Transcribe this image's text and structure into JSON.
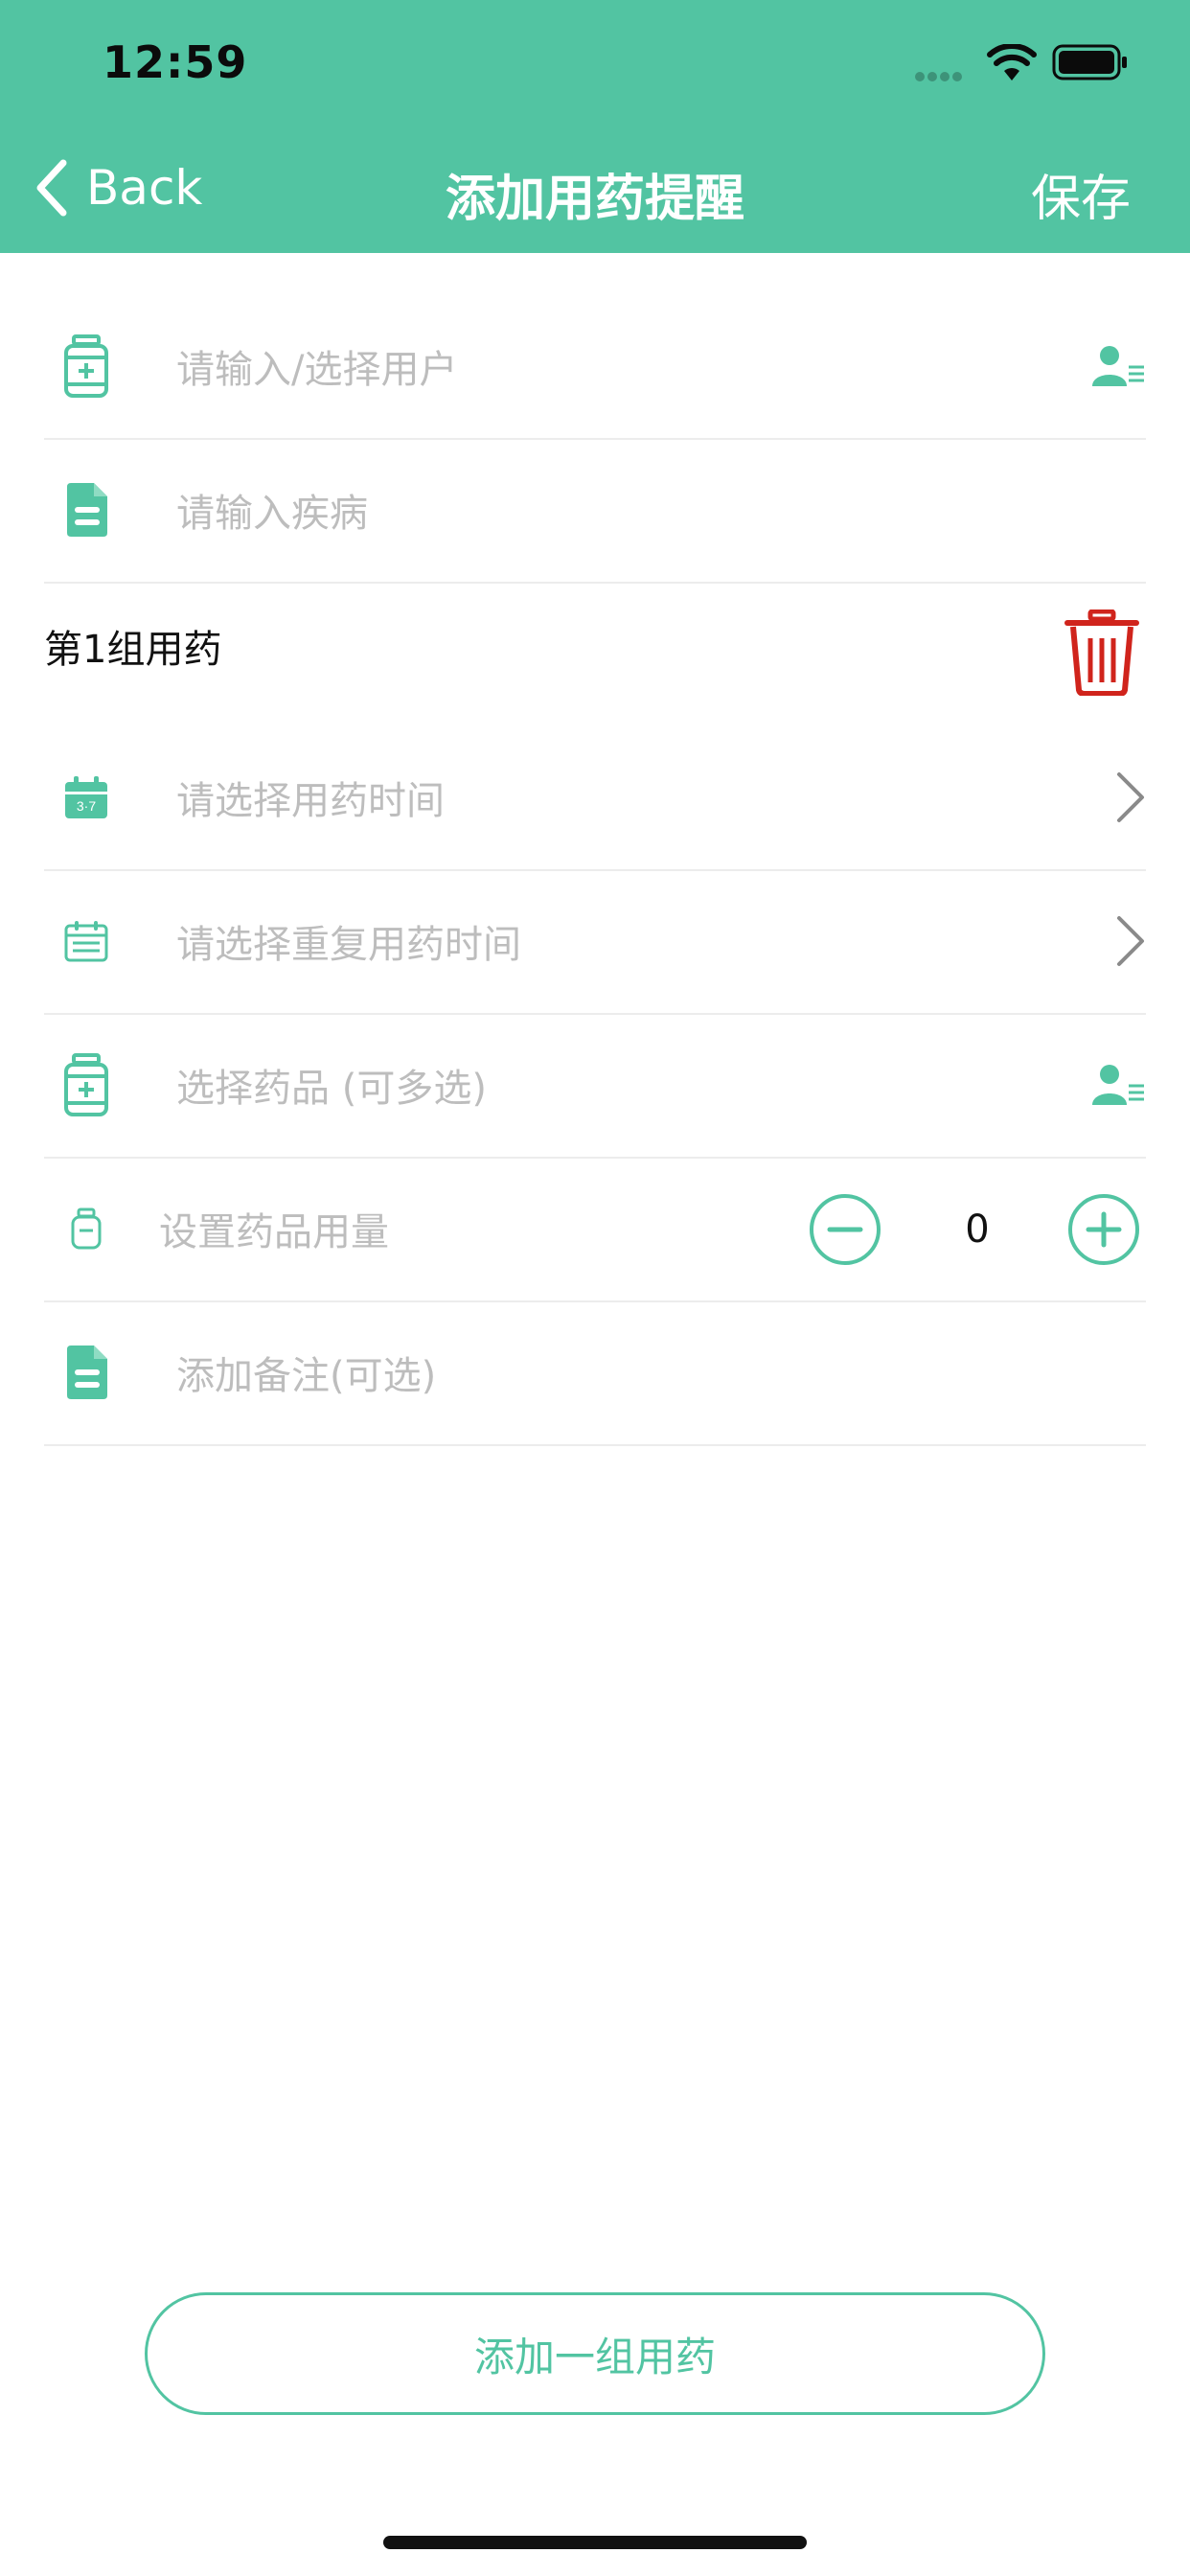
{
  "status_bar": {
    "time": "12:59"
  },
  "nav": {
    "back_label": "Back",
    "title": "添加用药提醒",
    "save_label": "保存"
  },
  "form": {
    "user_placeholder": "请输入/选择用户",
    "disease_placeholder": "请输入疾病",
    "group_title": "第1组用药",
    "time_placeholder": "请选择用药时间",
    "repeat_placeholder": "请选择重复用药时间",
    "medicine_placeholder": "选择药品 (可多选)",
    "dosage_label": "设置药品用量",
    "dosage_value": "0",
    "note_placeholder": "添加备注(可选)"
  },
  "footer": {
    "add_group_label": "添加一组用药"
  },
  "colors": {
    "accent": "#52c4a2",
    "danger": "#d0241c",
    "placeholder": "#bdbdbd"
  }
}
